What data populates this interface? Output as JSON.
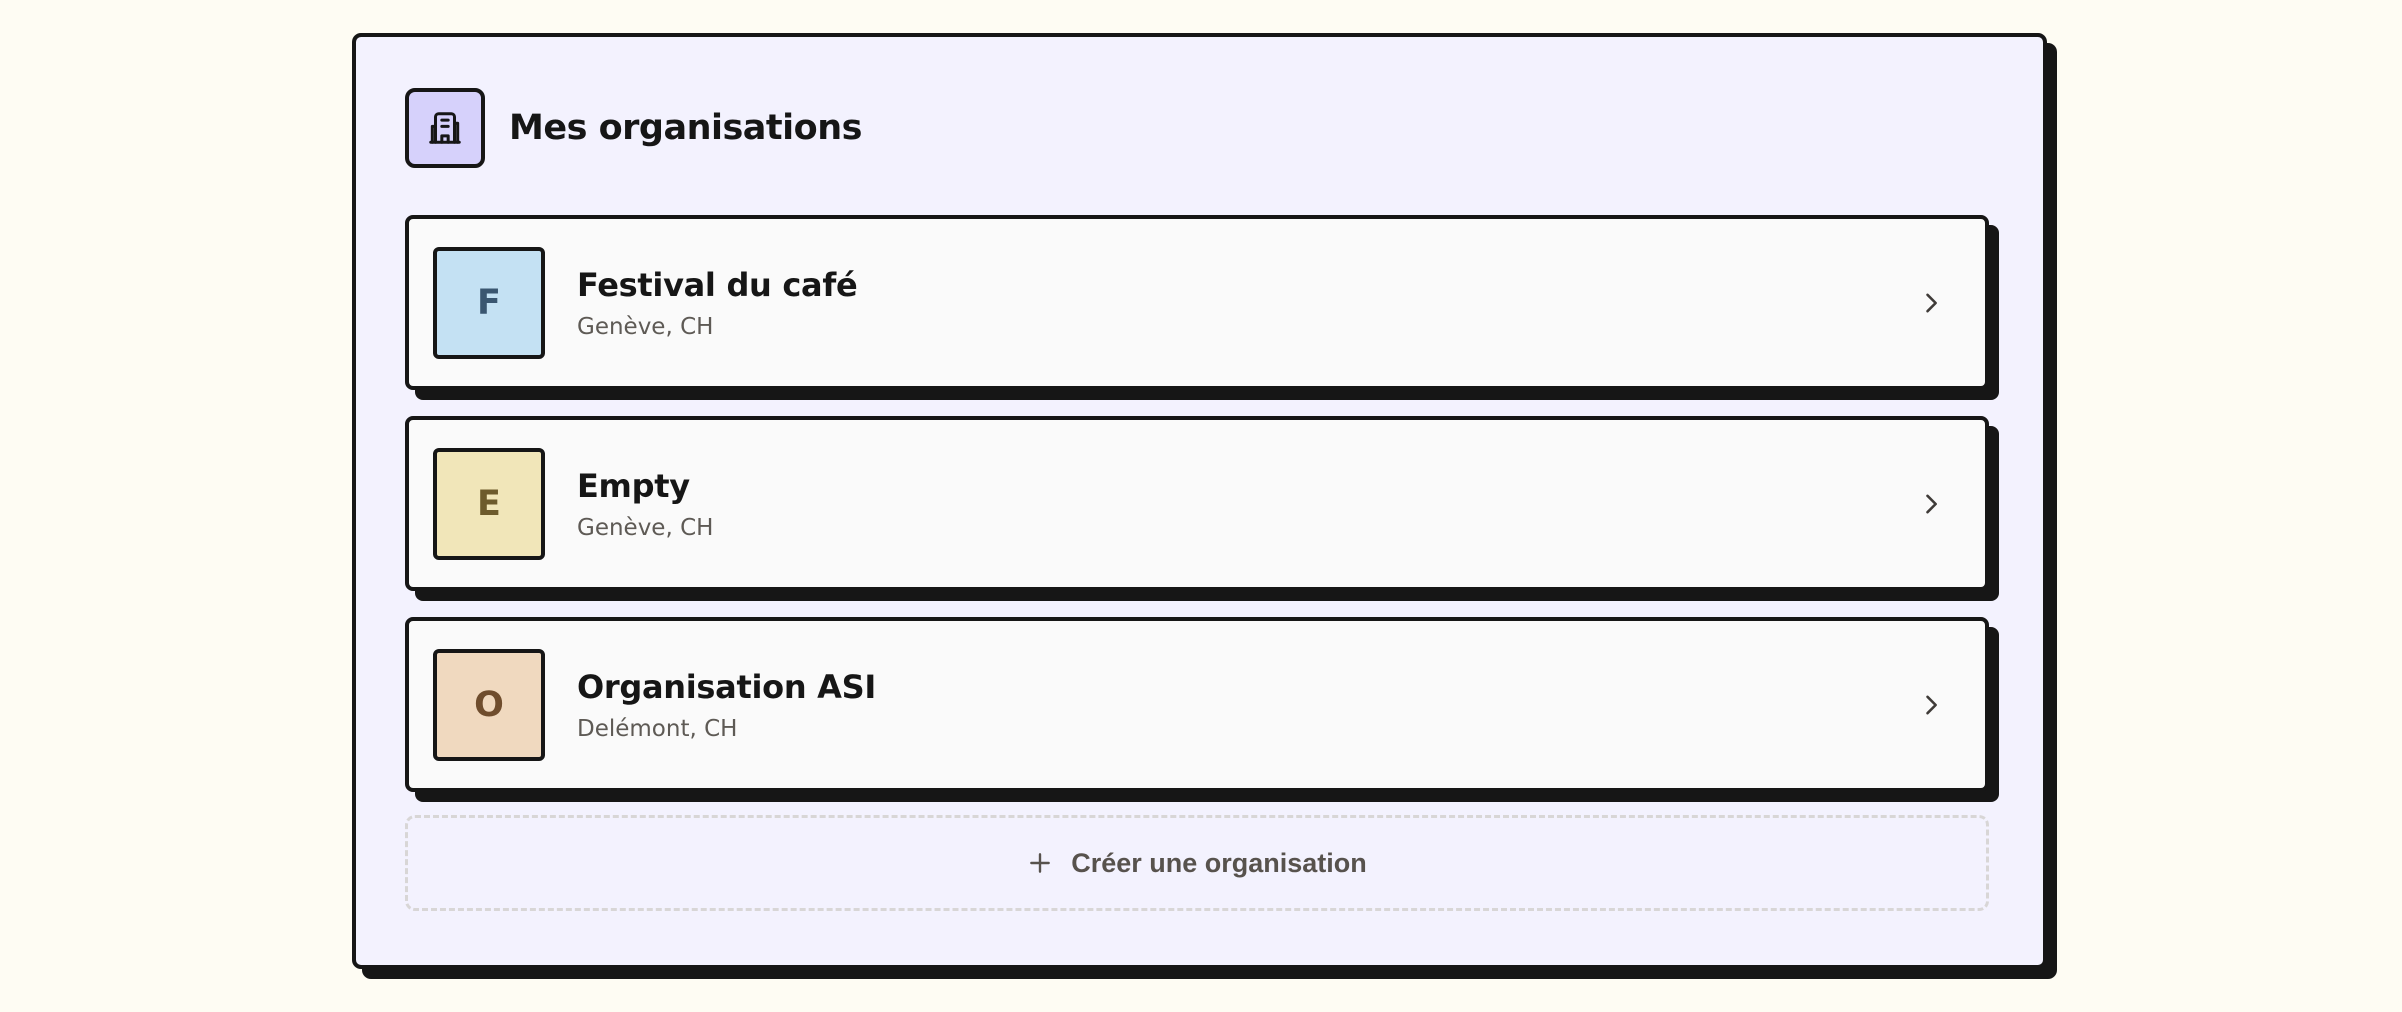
{
  "header": {
    "title": "Mes organisations",
    "icon": "building-icon"
  },
  "organizations": [
    {
      "initial": "F",
      "name": "Festival du café",
      "location": "Genève, CH",
      "avatar_bg": "#c4e1f3",
      "avatar_fg": "#3a5670"
    },
    {
      "initial": "E",
      "name": "Empty",
      "location": "Genève, CH",
      "avatar_bg": "#f1e6b9",
      "avatar_fg": "#6d5b2c"
    },
    {
      "initial": "O",
      "name": "Organisation ASI",
      "location": "Delémont, CH",
      "avatar_bg": "#f0d9bf",
      "avatar_fg": "#6f4d2d"
    }
  ],
  "create_button": {
    "label": "Créer une organisation",
    "icon": "plus-icon"
  },
  "colors": {
    "page_bg": "#fefcf3",
    "panel_bg": "#f3f2fe",
    "header_icon_bg": "#d6d1fb",
    "border": "#161616"
  }
}
